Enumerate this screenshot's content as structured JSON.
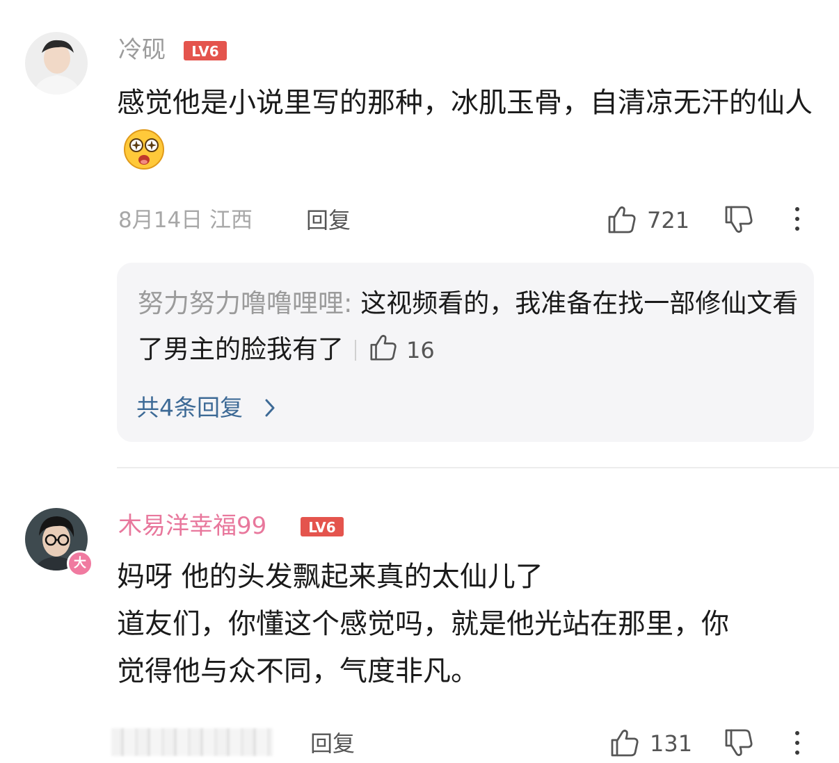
{
  "comments": [
    {
      "username": "冷砚",
      "level": "LV6",
      "content": "感觉他是小说里写的那种，冰肌玉骨，自清凉无汗的仙人",
      "date_location": "8月14日 江西",
      "reply_label": "回复",
      "likes": "721",
      "reply_preview": {
        "user": "努力努力噜噜哩哩",
        "text": "这视频看的，我准备在找一部修仙文看了男主的脸我有了",
        "likes": "16"
      },
      "more_replies": "共4条回复"
    },
    {
      "username": "木易洋幸福99",
      "level": "LV6",
      "avatar_badge": "大",
      "content_lines": [
        "妈呀 他的头发飘起来真的太仙儿了",
        "道友们，你懂这个感觉吗，就是他光站在那里，你",
        "觉得他与众不同，气度非凡。"
      ],
      "reply_label": "回复",
      "likes": "131"
    }
  ],
  "colors": {
    "level_badge": "#e4544d",
    "link_blue": "#3d6a96",
    "pink_name": "#e8779c"
  },
  "icons": [
    "thumbs-up-icon",
    "thumbs-down-icon",
    "more-vertical-icon",
    "chevron-right-icon",
    "astonished-emoji-icon"
  ]
}
